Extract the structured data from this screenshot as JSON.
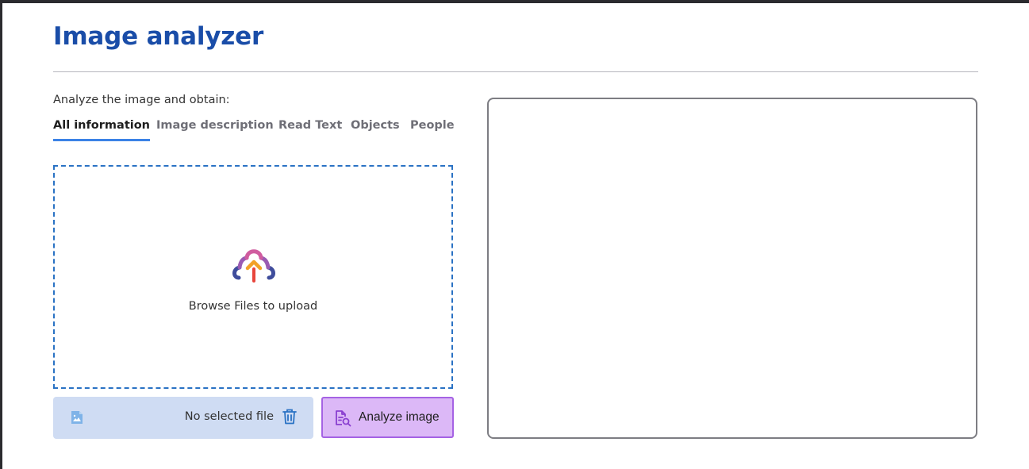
{
  "page": {
    "title": "Image analyzer"
  },
  "analyzer": {
    "subtitle": "Analyze the image and obtain:",
    "tabs": [
      {
        "label": "All information",
        "active": true
      },
      {
        "label": "Image description",
        "active": false
      },
      {
        "label": "Read Text",
        "active": false
      },
      {
        "label": "Objects",
        "active": false
      },
      {
        "label": "People",
        "active": false
      }
    ],
    "dropzone": {
      "text": "Browse Files to upload",
      "icon": "cloud-upload-icon"
    },
    "file": {
      "label": "No selected file",
      "icon": "image-file-icon",
      "delete_icon": "trash-icon"
    },
    "analyze_button": {
      "label": "Analyze image",
      "icon": "document-search-icon"
    }
  },
  "colors": {
    "title": "#1a4da8",
    "tab_active_underline": "#3b82e6",
    "dropzone_border": "#2a72c4",
    "file_bar_bg": "#cfdcf3",
    "analyze_bg": "#dcb8f7",
    "analyze_border": "#a562e4"
  }
}
